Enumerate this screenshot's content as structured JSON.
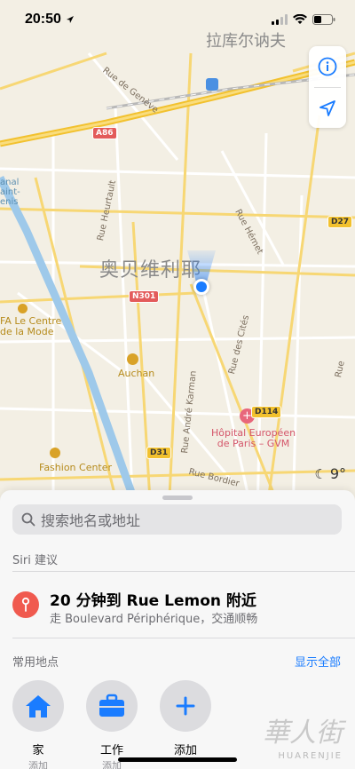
{
  "status_bar": {
    "time": "20:50"
  },
  "map": {
    "labels": {
      "top_cut": "拉库尔讷夫",
      "rue_de_geneve": "Rue de Genève",
      "rue_heurtault": "Rue Heurtault",
      "rue_hemet": "Rue Hémet",
      "rue_des_cites": "Rue des Cités",
      "rue_andre_karman": "Rue André Karman",
      "rue_bordier": "Rue Bordier",
      "rue_right": "Rue",
      "canal_1": "anal",
      "canal_2": "aint-",
      "canal_3": "enis",
      "city": "奥贝维利耶",
      "le_centre_1": "FA Le Centre",
      "le_centre_2": "de la Mode",
      "auchan": "Auchan",
      "hospital_1": "Hôpital Européen",
      "hospital_2": "de Paris – GVM",
      "fashion_center": "Fashion Center"
    },
    "shields": {
      "a86": "A86",
      "n301": "N301",
      "d27": "D27",
      "d114": "D114",
      "d31": "D31"
    },
    "weather": {
      "temp": "9°",
      "icon": "moon-icon"
    }
  },
  "sheet": {
    "search_placeholder": "搜索地名或地址",
    "siri_section": "Siri 建议",
    "siri_suggestion": {
      "title": "20 分钟到 Rue Lemon 附近",
      "subtitle": "走 Boulevard Périphérique，交通顺畅"
    },
    "favorites_section": "常用地点",
    "show_all": "显示全部",
    "favorites": [
      {
        "name": "家",
        "sub": "添加",
        "icon": "home-icon"
      },
      {
        "name": "工作",
        "sub": "添加",
        "icon": "briefcase-icon"
      },
      {
        "name": "添加",
        "sub": "",
        "icon": "plus-icon"
      }
    ]
  },
  "watermark": {
    "text": "華人街",
    "sub": "HUARENJIE"
  },
  "colors": {
    "accent": "#1a7cff",
    "pin": "#f05a4f",
    "road_major": "#f7d774"
  }
}
